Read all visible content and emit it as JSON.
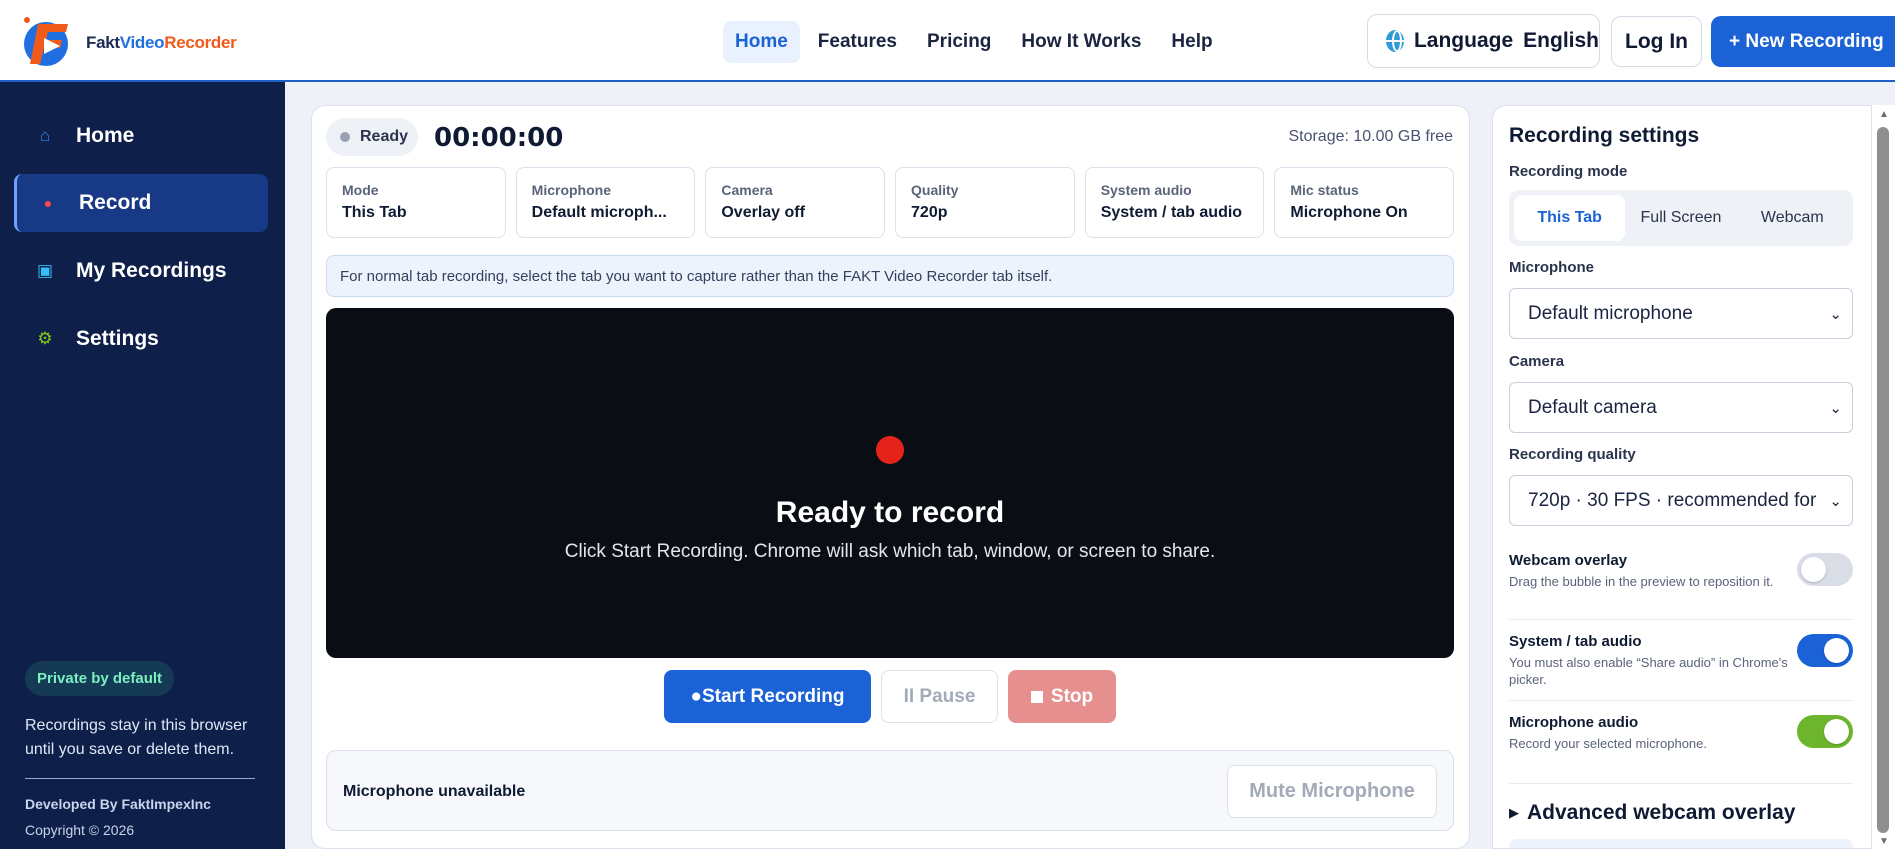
{
  "brand": {
    "name_part1": "Fakt",
    "name_part2": "Video",
    "name_part3": "Recorder"
  },
  "nav": {
    "items": [
      "Home",
      "Features",
      "Pricing",
      "How It Works",
      "Help"
    ],
    "active": "Home"
  },
  "header": {
    "language_label": "Language",
    "language_value": "English",
    "login": "Log In",
    "new_recording": "+ New Recording"
  },
  "sidebar": {
    "items": [
      {
        "label": "Home",
        "icon": "home-icon"
      },
      {
        "label": "Record",
        "icon": "record-dot-icon"
      },
      {
        "label": "My Recordings",
        "icon": "recordings-icon"
      },
      {
        "label": "Settings",
        "icon": "gear-icon"
      }
    ],
    "active": "Record",
    "badge": "Private by default",
    "note": "Recordings stay in this browser until you save or delete them.",
    "developer": "Developed By FaktImpexInc",
    "copyright": "Copyright © 2026"
  },
  "status": {
    "state": "Ready",
    "timer": "00:00:00",
    "storage": "Storage: 10.00 GB free"
  },
  "info": [
    {
      "label": "Mode",
      "value": "This Tab"
    },
    {
      "label": "Microphone",
      "value": "Default microph..."
    },
    {
      "label": "Camera",
      "value": "Overlay off"
    },
    {
      "label": "Quality",
      "value": "720p"
    },
    {
      "label": "System audio",
      "value": "System / tab audio"
    },
    {
      "label": "Mic status",
      "value": "Microphone On"
    }
  ],
  "tip": "For normal tab recording, select the tab you want to capture rather than the FAKT Video Recorder tab itself.",
  "preview": {
    "title": "Ready to record",
    "subtitle": "Click Start Recording. Chrome will ask which tab, window, or screen to share."
  },
  "controls": {
    "start": "●Start Recording",
    "pause": "II Pause",
    "stop": "Stop"
  },
  "mic": {
    "status": "Microphone unavailable",
    "mute": "Mute Microphone"
  },
  "settings": {
    "title": "Recording settings",
    "mode_label": "Recording mode",
    "modes": [
      "This Tab",
      "Full Screen",
      "Webcam"
    ],
    "active_mode": "This Tab",
    "microphone_label": "Microphone",
    "microphone_value": "Default microphone",
    "camera_label": "Camera",
    "camera_value": "Default camera",
    "quality_label": "Recording quality",
    "quality_value": "720p · 30 FPS · recommended for",
    "toggles": [
      {
        "title": "Webcam overlay",
        "desc": "Drag the bubble in the preview to reposition it.",
        "state": "off"
      },
      {
        "title": "System / tab audio",
        "desc": "You must also enable “Share audio” in Chrome's picker.",
        "state": "on"
      },
      {
        "title": "Microphone audio",
        "desc": "Record your selected microphone.",
        "state": "on"
      }
    ],
    "advanced": "Advanced webcam overlay"
  },
  "colors": {
    "accent": "#1a62d6",
    "sidebar": "#0e1f4a",
    "record_red": "#e5231b",
    "toggle_green": "#6cb52d"
  }
}
